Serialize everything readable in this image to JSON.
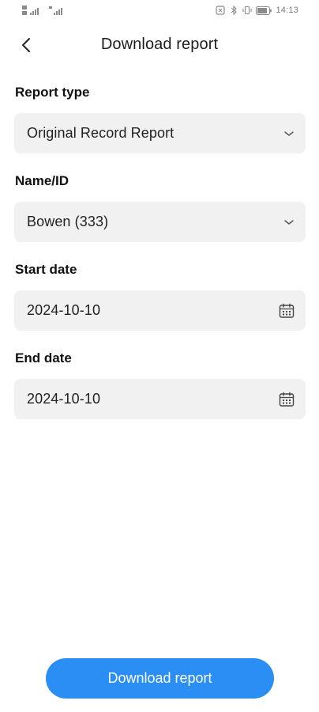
{
  "status_bar": {
    "time": "14:13",
    "left_icons": [
      "sim-signal-icon",
      "sim-signal-icon-2"
    ],
    "right_icons": [
      "nfc-icon",
      "bluetooth-icon",
      "vibrate-icon",
      "battery-icon"
    ]
  },
  "header": {
    "back_icon": "chevron-left-icon",
    "title": "Download report"
  },
  "form": {
    "report_type": {
      "label": "Report type",
      "value": "Original Record Report",
      "icon": "chevron-down-icon"
    },
    "name_id": {
      "label": "Name/ID",
      "value": "Bowen (333)",
      "icon": "chevron-down-icon"
    },
    "start_date": {
      "label": "Start date",
      "value": "2024-10-10",
      "icon": "calendar-icon"
    },
    "end_date": {
      "label": "End date",
      "value": "2024-10-10",
      "icon": "calendar-icon"
    }
  },
  "actions": {
    "download_label": "Download report"
  },
  "colors": {
    "accent": "#2b8ef5",
    "field_background": "#f1f1f1",
    "text": "#1c1c1c"
  }
}
